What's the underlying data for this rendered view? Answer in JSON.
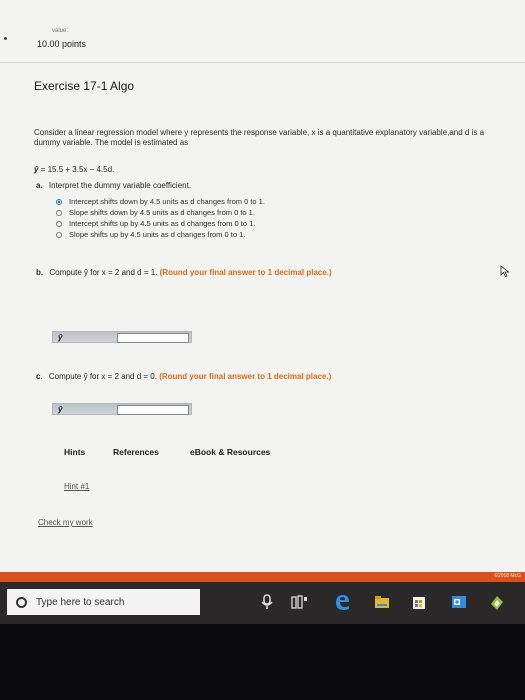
{
  "header": {
    "value_label": "value:",
    "points": "10.00 points"
  },
  "exercise": {
    "title": "Exercise 17-1 Algo",
    "description": "Consider a linear regression model where y represents the response variable, x is a quantitative explanatory variable,and d is a dummy variable. The model is estimated as",
    "model_hat": "ŷ",
    "model_equation": "= 15.5 + 3.5x − 4.5d."
  },
  "part_a": {
    "letter": "a.",
    "prompt": "Interpret the dummy variable coefficient.",
    "options": [
      "Intercept shifts down by 4.5 units as d changes from 0 to 1.",
      "Slope shifts down by 4.5 units as d changes from 0 to 1.",
      "Intercept shifts up by 4.5 units as d changes from 0 to 1.",
      "Slope shifts up by 4.5 units as d changes from 0 to 1."
    ],
    "selected_index": 0
  },
  "part_b": {
    "letter": "b.",
    "prompt": "Compute ŷ for x = 2 and d = 1.",
    "instruction": "(Round your final answer to 1 decimal place.)",
    "field_label": "ŷ",
    "value": ""
  },
  "part_c": {
    "letter": "c.",
    "prompt": "Compute ŷ for x = 2 and d = 0.",
    "instruction": "(Round your final answer to 1 decimal place.)",
    "field_label": "ŷ",
    "value": ""
  },
  "tabs": [
    "Hints",
    "References",
    "eBook & Resources"
  ],
  "hint_link": "Hint #1",
  "check_link": "Check my work",
  "copyright": "©2018 McG",
  "taskbar": {
    "search_placeholder": "Type here to search",
    "icons": [
      "microphone-icon",
      "task-view-icon",
      "edge-browser-icon",
      "file-explorer-icon",
      "store-icon",
      "outlook-icon",
      "app-icon"
    ]
  }
}
